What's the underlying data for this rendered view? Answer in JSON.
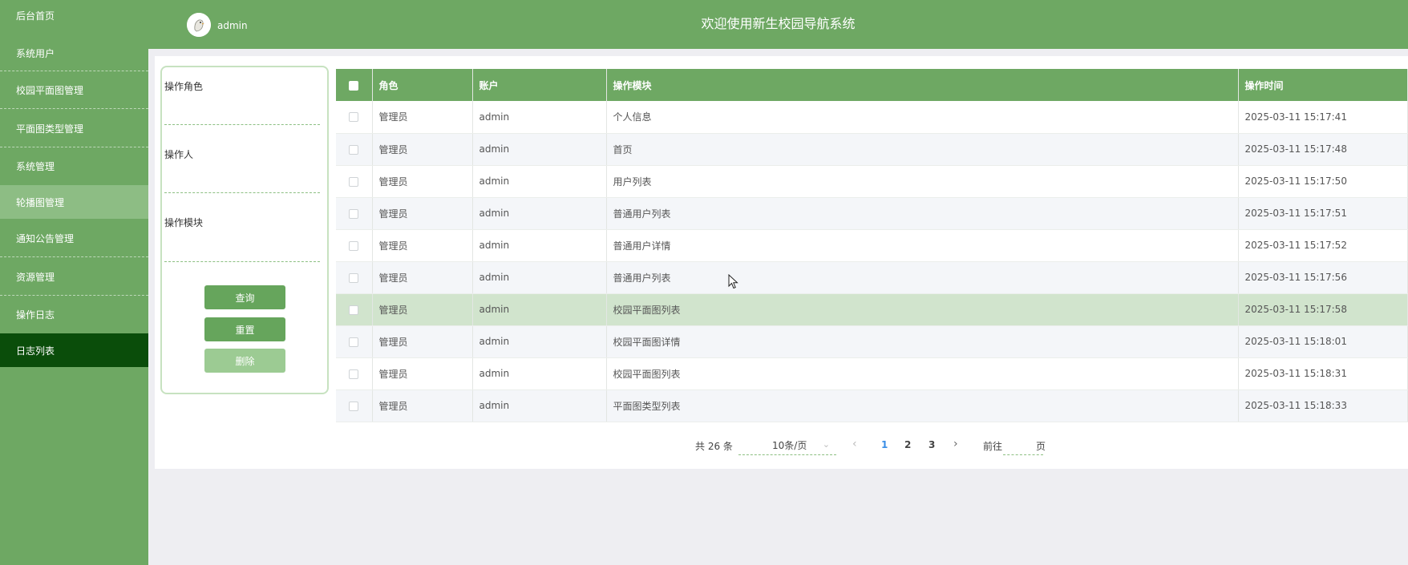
{
  "header": {
    "user_name": "admin",
    "title": "欢迎使用新生校园导航系统"
  },
  "sidebar": {
    "items": [
      {
        "label": "后台首页"
      },
      {
        "label": "系统用户"
      },
      {
        "label": "校园平面图管理"
      },
      {
        "label": "平面图类型管理"
      },
      {
        "label": "系统管理"
      },
      {
        "label": "轮播图管理"
      },
      {
        "label": "通知公告管理"
      },
      {
        "label": "资源管理"
      },
      {
        "label": "操作日志"
      },
      {
        "label": "日志列表"
      }
    ],
    "active_item": "日志列表"
  },
  "search": {
    "role_label": "操作角色",
    "operator_label": "操作人",
    "module_label": "操作模块",
    "query_button": "查询",
    "reset_button": "重置",
    "delete_button": "删除"
  },
  "table": {
    "columns": [
      "角色",
      "账户",
      "操作模块",
      "操作时间"
    ],
    "rows": [
      {
        "role": "管理员",
        "account": "admin",
        "module": "个人信息",
        "time": "2025-03-11 15:17:41"
      },
      {
        "role": "管理员",
        "account": "admin",
        "module": "首页",
        "time": "2025-03-11 15:17:48"
      },
      {
        "role": "管理员",
        "account": "admin",
        "module": "用户列表",
        "time": "2025-03-11 15:17:50"
      },
      {
        "role": "管理员",
        "account": "admin",
        "module": "普通用户列表",
        "time": "2025-03-11 15:17:51"
      },
      {
        "role": "管理员",
        "account": "admin",
        "module": "普通用户详情",
        "time": "2025-03-11 15:17:52"
      },
      {
        "role": "管理员",
        "account": "admin",
        "module": "普通用户列表",
        "time": "2025-03-11 15:17:56"
      },
      {
        "role": "管理员",
        "account": "admin",
        "module": "校园平面图列表",
        "time": "2025-03-11 15:17:58"
      },
      {
        "role": "管理员",
        "account": "admin",
        "module": "校园平面图详情",
        "time": "2025-03-11 15:18:01"
      },
      {
        "role": "管理员",
        "account": "admin",
        "module": "校园平面图列表",
        "time": "2025-03-11 15:18:31"
      },
      {
        "role": "管理员",
        "account": "admin",
        "module": "平面图类型列表",
        "time": "2025-03-11 15:18:33"
      }
    ]
  },
  "pagination": {
    "total_text": "共 26 条",
    "page_size": "10条/页",
    "pages": [
      "1",
      "2",
      "3"
    ],
    "current_page": "1",
    "goto_label": "前往",
    "page_label": "页"
  },
  "colors": {
    "theme_green": "#6ea863",
    "active_sidebar": "#0a4d0a",
    "row_hover": "#d1e4cd",
    "link_blue": "#3a8ee6"
  },
  "icons": [
    "avatar-icon",
    "checkbox-icon",
    "chevron-down-icon",
    "chevron-left-icon",
    "chevron-right-icon",
    "mouse-cursor-icon"
  ]
}
